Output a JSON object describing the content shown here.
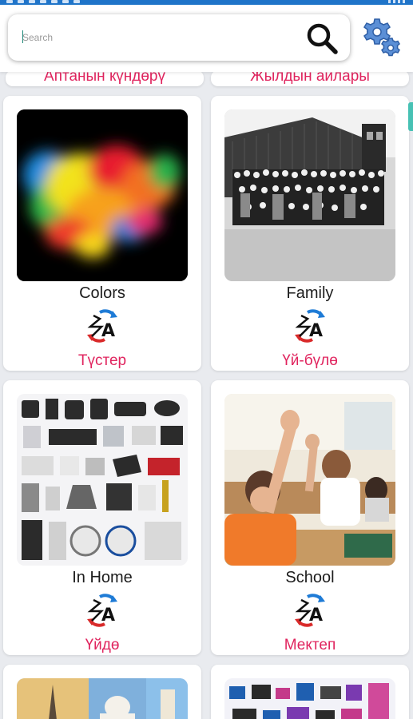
{
  "search": {
    "placeholder": "Search"
  },
  "cards_top": [
    {
      "kg": "Аптанын күндөрү"
    },
    {
      "kg": "Жылдын айлары"
    }
  ],
  "cards": [
    {
      "en": "Colors",
      "kg": "Түстер"
    },
    {
      "en": "Family",
      "kg": "Үй-бүлө"
    },
    {
      "en": "In Home",
      "kg": "Үйдө"
    },
    {
      "en": "School",
      "kg": "Мектеп"
    }
  ],
  "icons": {
    "search": "search-icon",
    "settings": "gear-icon",
    "translate": "translate-icon"
  },
  "colors": {
    "status_bar": "#1f74c9",
    "kyrgyz_text": "#e0245e",
    "scroll_accent": "#47c1b4"
  }
}
